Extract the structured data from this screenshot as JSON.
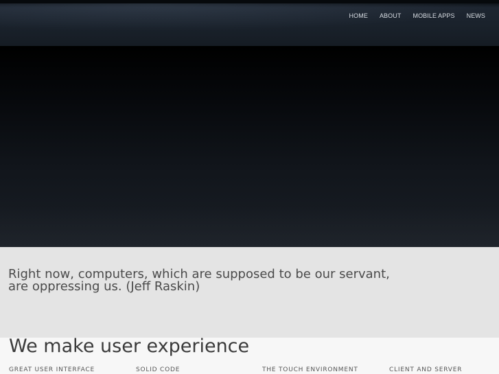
{
  "nav": {
    "items": [
      {
        "label": "HOME"
      },
      {
        "label": "ABOUT"
      },
      {
        "label": "MOBILE APPS"
      },
      {
        "label": "NEWS"
      }
    ]
  },
  "quote": {
    "line1": "Right now, computers, which are supposed to be our servant,",
    "line2": "are oppressing us. (Jeff Raskin)"
  },
  "main": {
    "headline": "We make user experience",
    "features": [
      "GREAT USER INTERFACE",
      "SOLID CODE",
      "THE TOUCH ENVIRONMENT",
      "CLIENT AND SERVER"
    ]
  }
}
